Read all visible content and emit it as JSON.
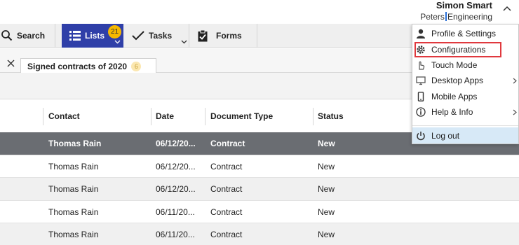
{
  "header": {
    "user_name": "Simon Smart",
    "company_part1": "Peters",
    "company_part2": "Engineering",
    "collapse_icon": "chevron-up-icon"
  },
  "toolbar": {
    "search_label": "Search",
    "lists_label": "Lists",
    "lists_badge": "21",
    "tasks_label": "Tasks",
    "forms_label": "Forms"
  },
  "tabs": {
    "active_label": "Signed contracts of 2020",
    "active_count": "6"
  },
  "table": {
    "columns": [
      "Contact",
      "Date",
      "Document Type",
      "Status"
    ],
    "rows": [
      {
        "contact": "Thomas Rain",
        "date": "06/12/20...",
        "type": "Contract",
        "status": "New"
      },
      {
        "contact": "Thomas Rain",
        "date": "06/12/20...",
        "type": "Contract",
        "status": "New"
      },
      {
        "contact": "Thomas Rain",
        "date": "06/12/20...",
        "type": "Contract",
        "status": "New"
      },
      {
        "contact": "Thomas Rain",
        "date": "06/11/20...",
        "type": "Contract",
        "status": "New"
      },
      {
        "contact": "Thomas Rain",
        "date": "06/11/20...",
        "type": "Contract",
        "status": "New"
      }
    ]
  },
  "menu": {
    "items": [
      {
        "label": "Profile & Settings",
        "icon": "user-icon"
      },
      {
        "label": "Configurations",
        "icon": "gear-icon"
      },
      {
        "label": "Touch Mode",
        "icon": "touch-icon"
      },
      {
        "label": "Desktop Apps",
        "icon": "monitor-icon"
      },
      {
        "label": "Mobile Apps",
        "icon": "mobile-icon"
      },
      {
        "label": "Help & Info",
        "icon": "info-icon"
      }
    ],
    "logout_label": "Log out"
  },
  "colors": {
    "lists_active": "#2f3fa8",
    "badge": "#f5b800",
    "selected_row": "#6a6d72",
    "highlight_outline": "#e0393e",
    "logout_bg": "#d7e9f7"
  }
}
